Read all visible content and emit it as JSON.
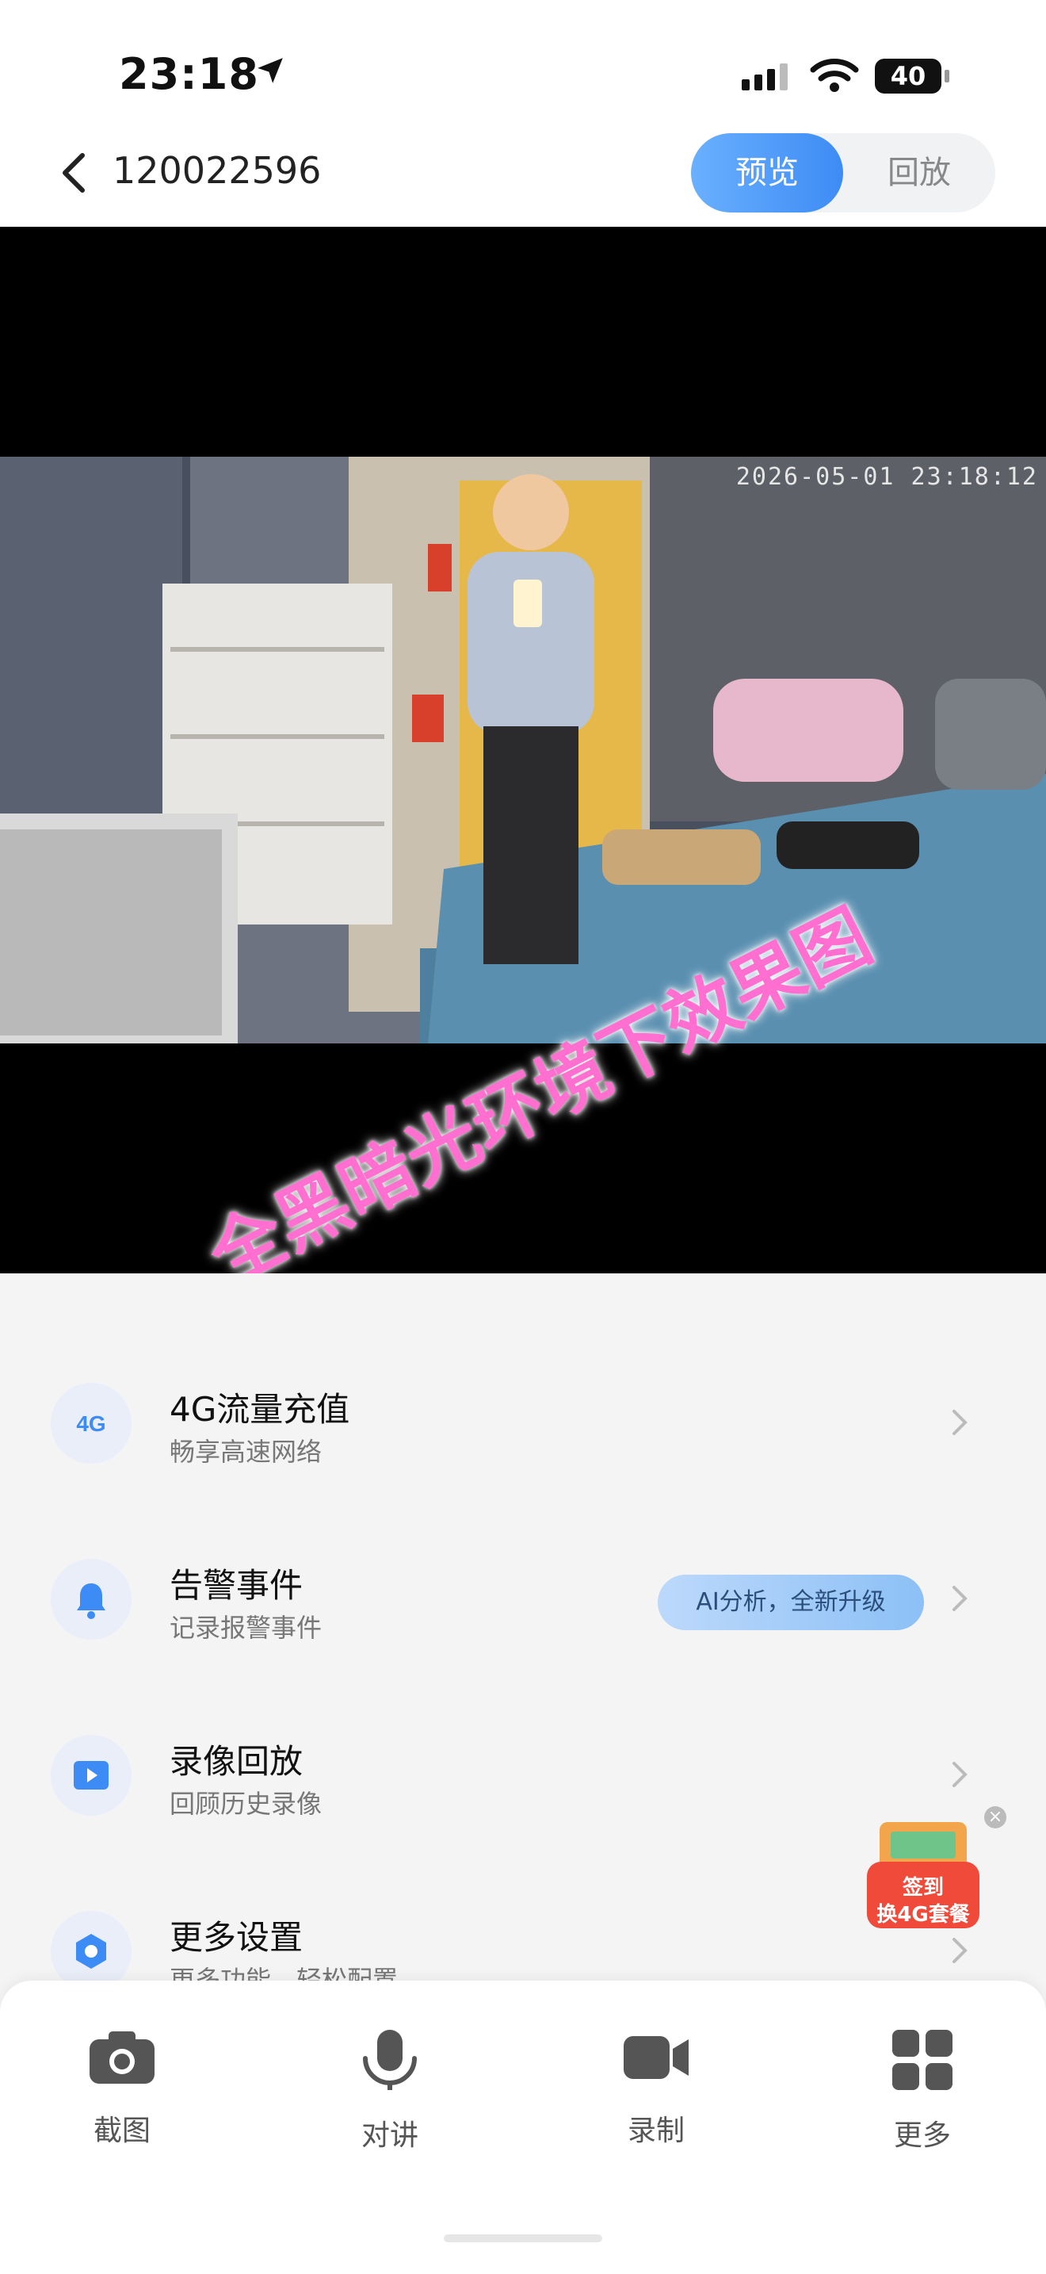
{
  "status_bar": {
    "time": "23:18",
    "battery": "40"
  },
  "header": {
    "title": "120022596",
    "tabs": [
      {
        "label": "预览",
        "active": true
      },
      {
        "label": "回放",
        "active": false
      }
    ]
  },
  "video": {
    "timestamp": "2026-05-01 23:18:12",
    "overlay_caption": "全黑暗光环境下效果图"
  },
  "menu": {
    "items": [
      {
        "title": "4G流量充值",
        "subtitle": "畅享高速网络",
        "icon": "4g-icon"
      },
      {
        "title": "告警事件",
        "subtitle": "记录报警事件",
        "badge": "AI分析，全新升级",
        "icon": "bell-icon"
      },
      {
        "title": "录像回放",
        "subtitle": "回顾历史录像",
        "icon": "play-icon"
      },
      {
        "title": "更多设置",
        "subtitle": "更多功能、轻松配置",
        "icon": "settings-icon"
      }
    ]
  },
  "promo": {
    "line1": "签到",
    "line2": "换4G套餐"
  },
  "toolbar": {
    "items": [
      {
        "label": "截图",
        "icon": "camera-icon"
      },
      {
        "label": "对讲",
        "icon": "microphone-icon"
      },
      {
        "label": "录制",
        "icon": "video-record-icon"
      },
      {
        "label": "更多",
        "icon": "grid-icon"
      }
    ]
  },
  "colors": {
    "accent": "#3d8cf5",
    "overlay_text": "#ff6fd0"
  }
}
